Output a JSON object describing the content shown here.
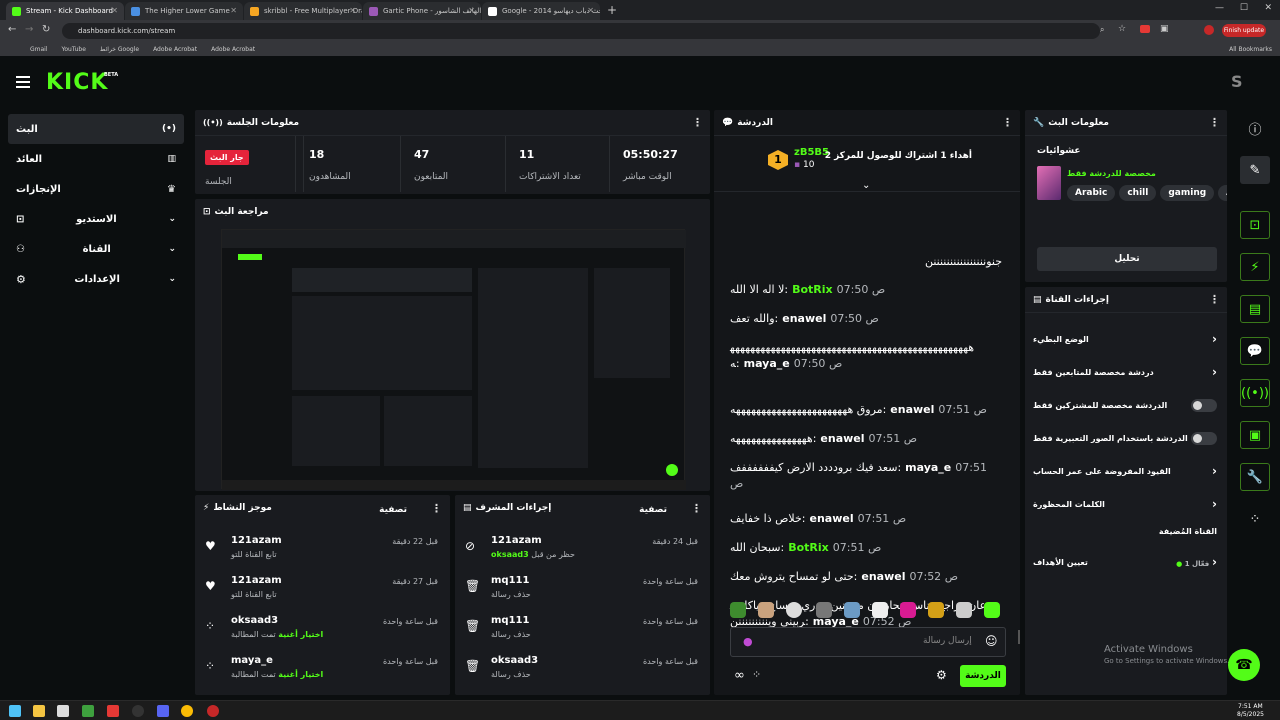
{
  "browser": {
    "tabs": [
      {
        "title": "Stream - Kick Dashboard",
        "active": true,
        "color": "#53fc18"
      },
      {
        "title": "The Higher Lower Game",
        "active": false,
        "color": "#4a90e2"
      },
      {
        "title": "skribbl - Free Multiplayer Drawi...",
        "active": false,
        "color": "#f5a623"
      },
      {
        "title": "Gartic Phone - الهاتف الشاسور",
        "active": false,
        "color": "#9b59b6"
      },
      {
        "title": "Google - بحث دباب ديهاسو 2014",
        "active": false,
        "color": "#ffffff"
      }
    ],
    "url": "dashboard.kick.com/stream",
    "bookmarks": [
      "Gmail",
      "YouTube",
      "خرائط Google",
      "Adobe Acrobat",
      "Adobe Acrobat"
    ],
    "all_bookmarks": "All Bookmarks",
    "finish_update": "Finish update"
  },
  "header": {
    "logo": "KICK",
    "logo_badge": "BETA",
    "avatar_letter": "S"
  },
  "sidebar": {
    "items": [
      {
        "label": "البث",
        "icon": "broadcast-icon"
      },
      {
        "label": "العائد",
        "icon": "chart-icon"
      },
      {
        "label": "الإنجازات",
        "icon": "trophy-icon"
      },
      {
        "label": "الاستديو",
        "icon": "studio-icon"
      },
      {
        "label": "القناة",
        "icon": "channel-icon"
      },
      {
        "label": "الإعدادات",
        "icon": "gear-icon"
      }
    ]
  },
  "session": {
    "title": "معلومات الجلسة",
    "live_badge": "جار البث",
    "live_label": "الجلسة",
    "stats": [
      {
        "value": "18",
        "label": "المشاهدون"
      },
      {
        "value": "47",
        "label": "المتابعون"
      },
      {
        "value": "11",
        "label": "تعداد الاشتراكات"
      },
      {
        "value": "05:50:27",
        "label": "الوقت مباشر"
      }
    ]
  },
  "preview": {
    "title": "مراجعة البث"
  },
  "activity": {
    "title": "موجز النشاط",
    "filter": "تصفية",
    "items": [
      {
        "name": "121azam",
        "desc": "تابع القناة للتو",
        "time": "قبل 22 دقيقة",
        "icon": "heart-icon"
      },
      {
        "name": "121azam",
        "desc": "تابع القناة للتو",
        "time": "قبل 27 دقيقة",
        "icon": "heart-icon"
      },
      {
        "name": "oksaad3",
        "desc": "تمت المطالبة",
        "highlight": "اختيار أغنية",
        "time": "قبل ساعة واحدة",
        "icon": "dots-icon"
      },
      {
        "name": "maya_e",
        "desc": "تمت المطالبة",
        "highlight": "اختيار أغنية",
        "time": "قبل ساعة واحدة",
        "icon": "dots-icon"
      }
    ]
  },
  "mod_actions": {
    "title": "إجراءات المشرف",
    "filter": "تصفية",
    "items": [
      {
        "name": "121azam",
        "desc": "حظر من قبل",
        "highlight": "oksaad3",
        "time": "قبل 24 دقيقة",
        "icon": "ban-icon"
      },
      {
        "name": "mq111",
        "desc": "حذف رسالة",
        "time": "قبل ساعة واحدة",
        "icon": "trash-icon"
      },
      {
        "name": "mq111",
        "desc": "حذف رسالة",
        "time": "قبل ساعة واحدة",
        "icon": "trash-icon"
      },
      {
        "name": "oksaad3",
        "desc": "حذف رسالة",
        "time": "قبل ساعة واحدة",
        "icon": "trash-icon"
      }
    ]
  },
  "chat": {
    "title": "الدردشة",
    "pinned": {
      "user": "zB5B5",
      "level": "1",
      "count": "10",
      "text": "أهداء 1 اشتراك للوصول للمركز 2"
    },
    "messages": [
      {
        "text": "جنوننننننننننننننننن"
      },
      {
        "user": "BotRix",
        "time": "07:50 ص",
        "text": "لا اله الا الله",
        "color": "#53fc18"
      },
      {
        "user": "enawel",
        "time": "07:50 ص",
        "text": "والله تعف",
        "color": "#ffffff"
      },
      {
        "user": "maya_e",
        "time": "07:50 ص",
        "text": "ههههههههههههههههههههههههههههههههههههههههههههههههه",
        "color": "#ffffff"
      },
      {
        "user": "enawel",
        "time": "07:51 ص",
        "text": "مروق هههههههههههههههههههههههه",
        "color": "#ffffff"
      },
      {
        "user": "enawel",
        "time": "07:51 ص",
        "text": "هههههههههههههههه",
        "color": "#ffffff"
      },
      {
        "user": "maya_e",
        "time": "07:51 ص",
        "text": "سعد فيك برودددد الارض كيففففففف",
        "color": "#ffffff"
      },
      {
        "user": "enawel",
        "time": "07:51 ص",
        "text": "خلاص ذا خفايف",
        "color": "#ffffff"
      },
      {
        "user": "BotRix",
        "time": "07:51 ص",
        "text": "سبحان الله",
        "color": "#53fc18"
      },
      {
        "user": "enawel",
        "time": "07:52 ص",
        "text": "حتى لو تمساح يتروش معك",
        "color": "#ffffff"
      },
      {
        "user": "maya_e",
        "time": "07:52 ص",
        "text": "جوعان وراجع وناس يتحاربون مع تنين مدري تمساح وياكل مربيني وينننننننننن",
        "color": "#ffffff"
      }
    ],
    "input_placeholder": "إرسال رسالة",
    "send_label": "الدردشة"
  },
  "stream_info": {
    "title": "معلومات البث",
    "category_label": "عشوائيات",
    "category_note": "مخصصة للدردشة فقط",
    "tags": [
      "Arabic",
      "chill",
      "gaming",
      "AF"
    ],
    "edit_label": "تحليل"
  },
  "channel_actions": {
    "title": "إجراءات القناة",
    "rows": [
      {
        "label": "الوضع البطيء",
        "type": "chevron"
      },
      {
        "label": "دردشة مخصصة للمتابعين فقط",
        "type": "chevron"
      },
      {
        "label": "الدردشة مخصصة للمشتركين فقط",
        "type": "toggle"
      },
      {
        "label": "الدردشة باستخدام الصور التعبيرية فقط",
        "type": "toggle"
      },
      {
        "label": "القيود المفروضة على عمر الحساب",
        "type": "chevron"
      },
      {
        "label": "الكلمات المحظورة",
        "type": "chevron"
      }
    ],
    "hosted_label": "القناة المُضيفة",
    "goals_label": "تعيين الأهداف",
    "goals_status": "فعّال 1"
  },
  "windows": {
    "activate_title": "Activate Windows",
    "activate_sub": "Go to Settings to activate Windows."
  },
  "clock": {
    "time": "7:51 AM",
    "date": "8/5/2025"
  }
}
